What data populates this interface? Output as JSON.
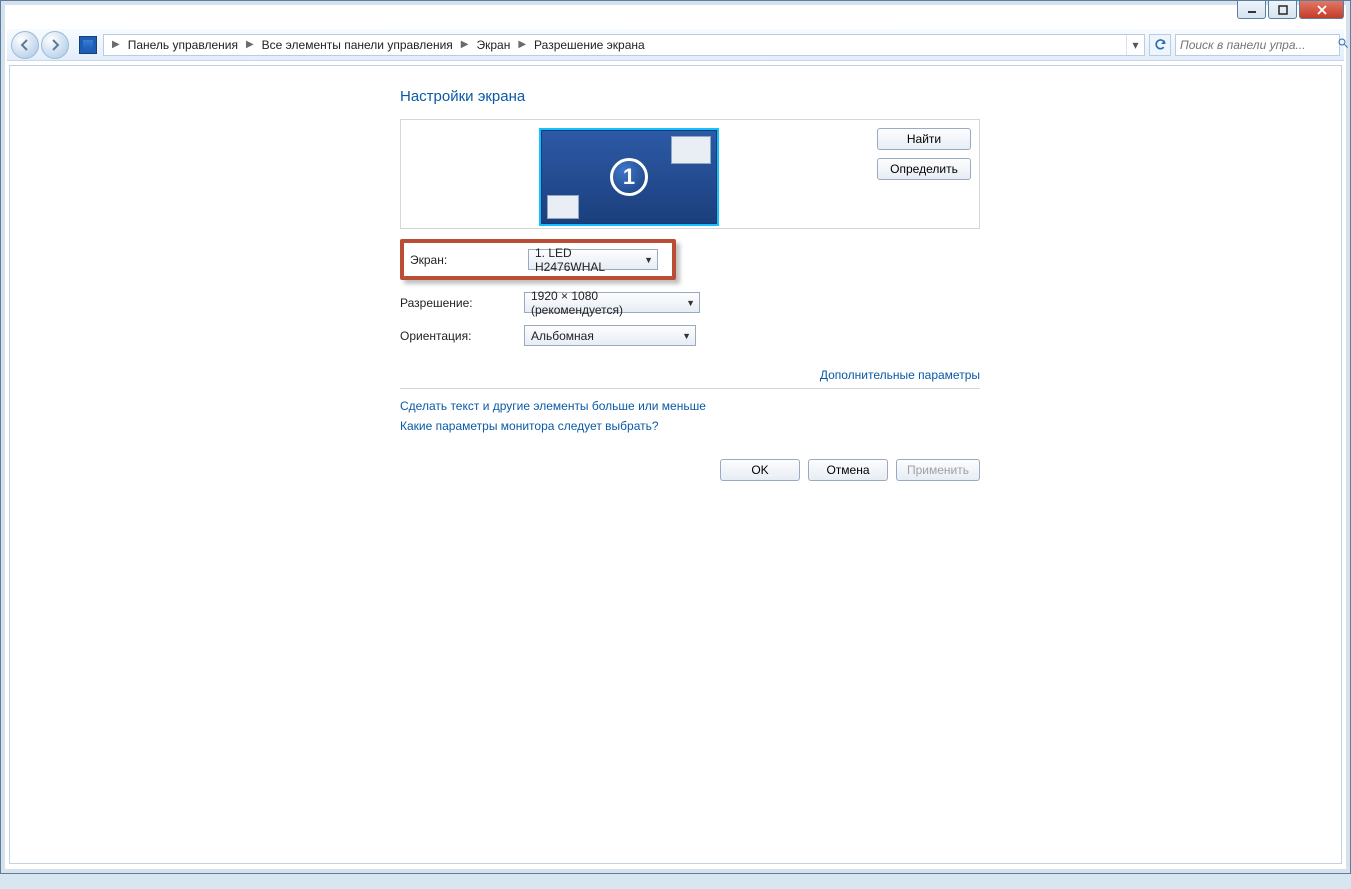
{
  "window_controls": {
    "minimize": "–",
    "maximize": "❐",
    "close": "✕"
  },
  "breadcrumb": {
    "items": [
      "Панель управления",
      "Все элементы панели управления",
      "Экран",
      "Разрешение экрана"
    ]
  },
  "search": {
    "placeholder": "Поиск в панели упра..."
  },
  "page": {
    "title": "Настройки экрана",
    "monitor_number": "1",
    "buttons": {
      "find": "Найти",
      "identify": "Определить"
    },
    "fields": {
      "screen_label": "Экран:",
      "screen_value": "1. LED H2476WHAL",
      "resolution_label": "Разрешение:",
      "resolution_value": "1920 × 1080 (рекомендуется)",
      "orientation_label": "Ориентация:",
      "orientation_value": "Альбомная"
    },
    "advanced_link": "Дополнительные параметры",
    "helper_links": {
      "a": "Сделать текст и другие элементы больше или меньше",
      "b": "Какие параметры монитора следует выбрать?"
    },
    "actions": {
      "ok": "OK",
      "cancel": "Отмена",
      "apply": "Применить"
    }
  }
}
